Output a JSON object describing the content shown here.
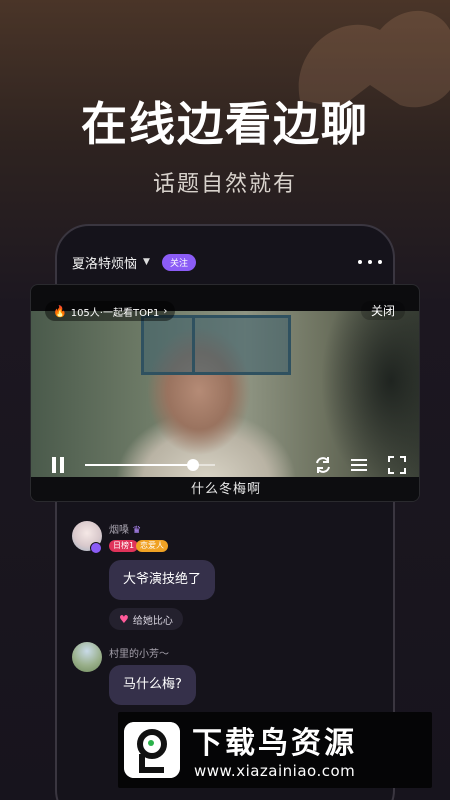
{
  "promo": {
    "headline": "在线边看边聊",
    "subline": "话题自然就有"
  },
  "room": {
    "name": "夏洛特烦恼",
    "follow_label": "关注",
    "more_icon": "more-dots-icon"
  },
  "player": {
    "viewer_pill": "105人·一起看TOP1",
    "close_label": "关闭",
    "subtitle": "什么冬梅啊",
    "progress": 0.83,
    "icons": [
      "pause-icon",
      "refresh-icon",
      "playlist-icon",
      "fullscreen-icon"
    ]
  },
  "chat": {
    "messages": [
      {
        "user": "烟嗓",
        "badges": [
          "日榜1",
          "恋爱人"
        ],
        "text": "大爷演技绝了",
        "action": "给她比心"
      },
      {
        "user": "村里的小芳～",
        "text": "马什么梅?"
      }
    ]
  },
  "watermark": {
    "title": "下载鸟资源",
    "url": "www.xiazainiao.com"
  },
  "colors": {
    "accent": "#8b5cf6",
    "bubble": "#35304a",
    "badge_rank": "#e0335a",
    "badge_star": "#f0a224"
  }
}
